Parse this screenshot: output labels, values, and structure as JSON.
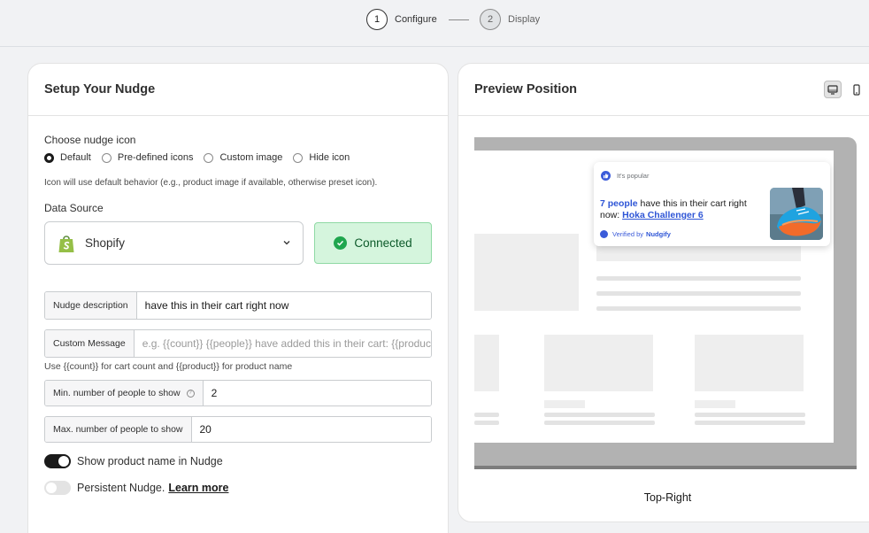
{
  "stepper": {
    "steps": [
      {
        "number": "1",
        "label": "Configure",
        "state": "active"
      },
      {
        "number": "2",
        "label": "Display",
        "state": "inactive"
      }
    ]
  },
  "setup": {
    "title": "Setup Your Nudge",
    "icon_choice": {
      "label": "Choose nudge icon",
      "options": [
        "Default",
        "Pre-defined icons",
        "Custom image",
        "Hide icon"
      ],
      "selected": "Default",
      "hint": "Icon will use default behavior (e.g., product image if available, otherwise preset icon)."
    },
    "data_source": {
      "label": "Data Source",
      "selected": "Shopify",
      "status": "Connected"
    },
    "nudge_description": {
      "label": "Nudge description",
      "value": "have this in their cart right now"
    },
    "custom_message": {
      "label": "Custom Message",
      "value": "",
      "placeholder": "e.g. {{count}} {{people}} have added this in their cart: {{product}}",
      "hint": "Use {{count}} for cart count and {{product}} for product name"
    },
    "min_people": {
      "label": "Min. number of people to show",
      "value": "2"
    },
    "max_people": {
      "label": "Max. number of people to show",
      "value": "20"
    },
    "show_product_name": {
      "label": "Show product name in Nudge",
      "on": true
    },
    "persistent_nudge": {
      "label": "Persistent Nudge.",
      "link": "Learn more",
      "on": false
    }
  },
  "preview": {
    "title": "Preview Position",
    "device_selected": "desktop",
    "nudge": {
      "tag": "It's popular",
      "count_text": "7 people",
      "message": " have this in their cart right now: ",
      "product": "Hoka Challenger 6",
      "verified_prefix": "Verified by",
      "verified_brand": "Nudgify"
    },
    "position": "Top-Right"
  },
  "colors": {
    "accent_blue": "#2e55d6",
    "connected_bg": "#d5f5dd",
    "connected_border": "#8fd9a4",
    "shopify_green": "#95bf47"
  }
}
